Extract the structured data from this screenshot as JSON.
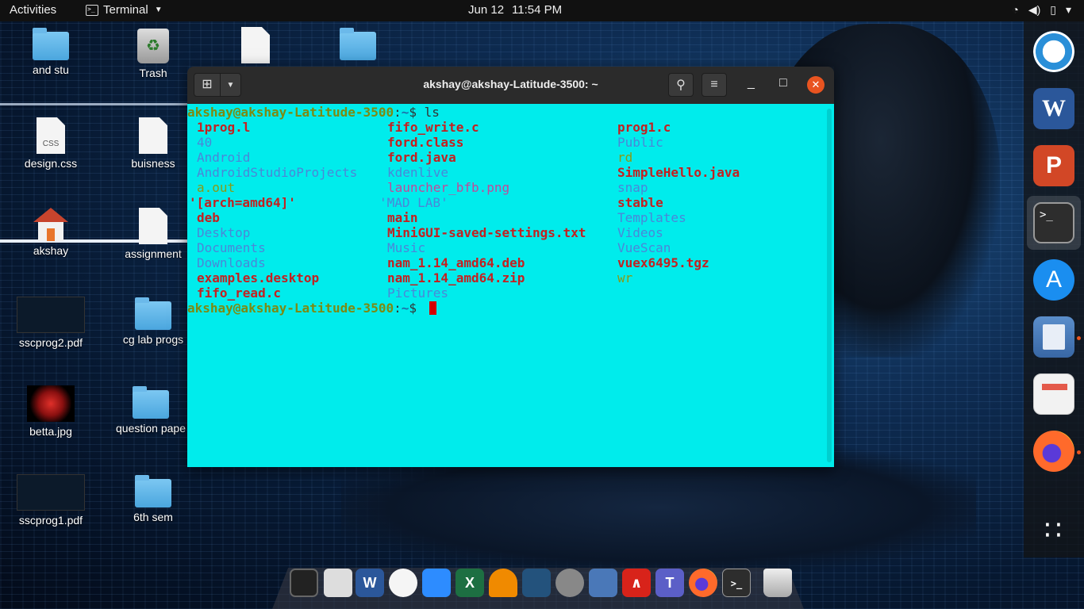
{
  "topbar": {
    "activities": "Activities",
    "app_name": "Terminal",
    "date": "Jun 12",
    "time": "11:54 PM",
    "tray": {
      "wifi": "◔",
      "volume": "◀)",
      "battery": "▯",
      "menu": "▾"
    }
  },
  "desktop": {
    "icons": {
      "and_stu": "and stu",
      "trash": "Trash",
      "design_css": "design.css",
      "design_css_badge": "CSS",
      "buisness": "buisness",
      "akshay": "akshay",
      "assignment": "assignment",
      "sscprog2": "sscprog2.pdf",
      "cg_lab": "cg lab progs",
      "betta": "betta.jpg",
      "question": "question pape",
      "sscprog1": "sscprog1.pdf",
      "sixth_sem": "6th sem"
    }
  },
  "terminal": {
    "title": "akshay@akshay-Latitude-3500: ~",
    "new_tab_icon": "⊞",
    "dropdown_icon": "▼",
    "search_icon": "⚲",
    "menu_icon": "≡",
    "minimize_icon": "_",
    "maximize_icon": "□",
    "close_icon": "✕",
    "prompt_user": "akshay@akshay-Latitude-3500",
    "prompt_sep": ":",
    "prompt_path": "~",
    "prompt_sign": "$ ",
    "command": "ls",
    "listing": {
      "col1": [
        "1prog.l",
        "40",
        "Android",
        "AndroidStudioProjects",
        "a.out",
        "'[arch=amd64]'",
        "deb",
        "Desktop",
        "Documents",
        "Downloads",
        "examples.desktop",
        "fifo_read.c"
      ],
      "col2": [
        "fifo_write.c",
        "ford.class",
        "ford.java",
        "kdenlive",
        "launcher_bfb.png",
        "'MAD LAB'",
        "main",
        "MiniGUI-saved-settings.txt",
        "Music",
        "nam_1.14_amd64.deb",
        "nam_1.14_amd64.zip",
        "Pictures"
      ],
      "col3": [
        "prog1.c",
        "Public",
        "rd",
        "SimpleHello.java",
        "snap",
        "stable",
        "Templates",
        "Videos",
        "VueScan",
        "vuex6495.tgz",
        "wr",
        ""
      ]
    }
  },
  "side_dock": {
    "word_letter": "W",
    "ppt_letter": "P",
    "terminal_glyph": ">_",
    "store_glyph": "A",
    "apps_grid": "∷"
  },
  "bottom_dock": {
    "word_letter": "W",
    "excel_letter": "X",
    "pdf_glyph": "∧",
    "teams_letter": "T",
    "terminal_glyph": ">_"
  },
  "colors": {
    "terminal_bg": "#00ecec",
    "accent_close": "#e95420",
    "file_red": "#c42020",
    "dir_blue": "#4a87d8",
    "link_olive": "#8a9a15"
  }
}
